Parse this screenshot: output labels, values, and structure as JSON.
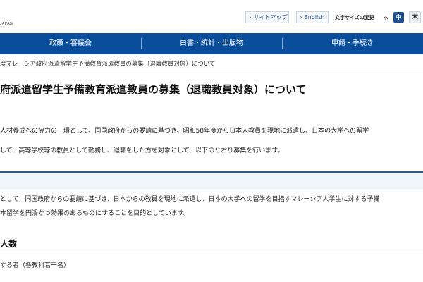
{
  "header": {
    "logo_text": "JAPAN",
    "utility": {
      "sitemap_label": "サイトマップ",
      "english_label": "English",
      "fontsize_label": "文字サイズの変更",
      "fontsize_small": "小",
      "fontsize_medium": "中",
      "fontsize_large": "大"
    }
  },
  "nav": {
    "items": [
      {
        "label": "政策・審議会"
      },
      {
        "label": "白書・統計・出版物"
      },
      {
        "label": "申請・手続き"
      }
    ]
  },
  "breadcrumb": {
    "text": "度マレーシア政府派遣留学生予備教育派遣教員の募集（退職教員対象）について"
  },
  "main": {
    "title": "府派遣留学生予備教育派遣教員の募集（退職教員対象）について",
    "intro_line1": "人材養成への協力の一環として、同国政府からの要請に基づき、昭和58年度から日本人教員を現地に派遣し、日本の大学への留学",
    "intro_line2": "して、高等学校等の教員として勤務し、退職をした方を対象として、以下のとおり募集を行います。",
    "section1": {
      "line1": "として、同国政府からの要請に基づき、日本からの教員を現地に派遣し、日本の大学への留学を目指すマレーシア人学生に対する予備",
      "line2": "本留学を円滑かつ効果のあるものにすることを目的としています。"
    },
    "section2": {
      "heading": "人数",
      "line1": "する者（各教科若干名）"
    }
  },
  "colors": {
    "nav_bg": "#0a4e9b",
    "accent": "#1d5aa8"
  }
}
